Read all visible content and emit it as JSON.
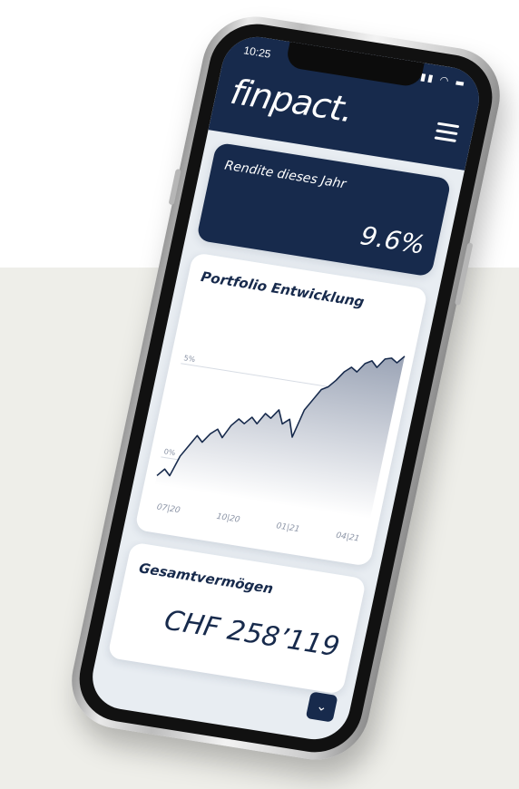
{
  "status_bar": {
    "time": "10:25",
    "icons": [
      "signal-icon",
      "wifi-icon",
      "battery-icon"
    ]
  },
  "header": {
    "logo": "finpact.",
    "menu_icon": "hamburger-menu-icon"
  },
  "return_card": {
    "label": "Rendite dieses Jahr",
    "value": "9.6%"
  },
  "portfolio_card": {
    "title": "Portfolio Entwicklung"
  },
  "chart_data": {
    "type": "area",
    "x": [
      "07|20",
      "10|20",
      "01|21",
      "04|21"
    ],
    "xticks": [
      "07|20",
      "10|20",
      "01|21",
      "04|21"
    ],
    "yticks": [
      "0%",
      "5%"
    ],
    "ylim": [
      -1.5,
      8
    ],
    "grid": true,
    "series": [
      {
        "values": [
          -1.0,
          -0.6,
          -0.9,
          0.2,
          0.8,
          1.4,
          1.1,
          1.6,
          1.9,
          1.5,
          2.2,
          2.6,
          2.4,
          2.8,
          2.5,
          3.1,
          2.9,
          3.4,
          2.7,
          3.0,
          2.1,
          3.6,
          4.2,
          4.8,
          5.0,
          5.4,
          5.9,
          6.2,
          6.0,
          6.5,
          6.7,
          6.4,
          6.9,
          7.0,
          6.8,
          7.2
        ]
      }
    ],
    "colors": {
      "line": "#172a4c",
      "fill_top": "#9aa3b5",
      "fill_bottom": "#ffffff"
    }
  },
  "wealth_card": {
    "title": "Gesamtvermögen",
    "value": "CHF 258’119"
  },
  "scroll_button": {
    "icon": "chevron-down-icon",
    "glyph": "⌄"
  },
  "colors": {
    "navy": "#172a4c",
    "screen_bg": "#e8edf2",
    "page_band": "#eeeee9"
  }
}
